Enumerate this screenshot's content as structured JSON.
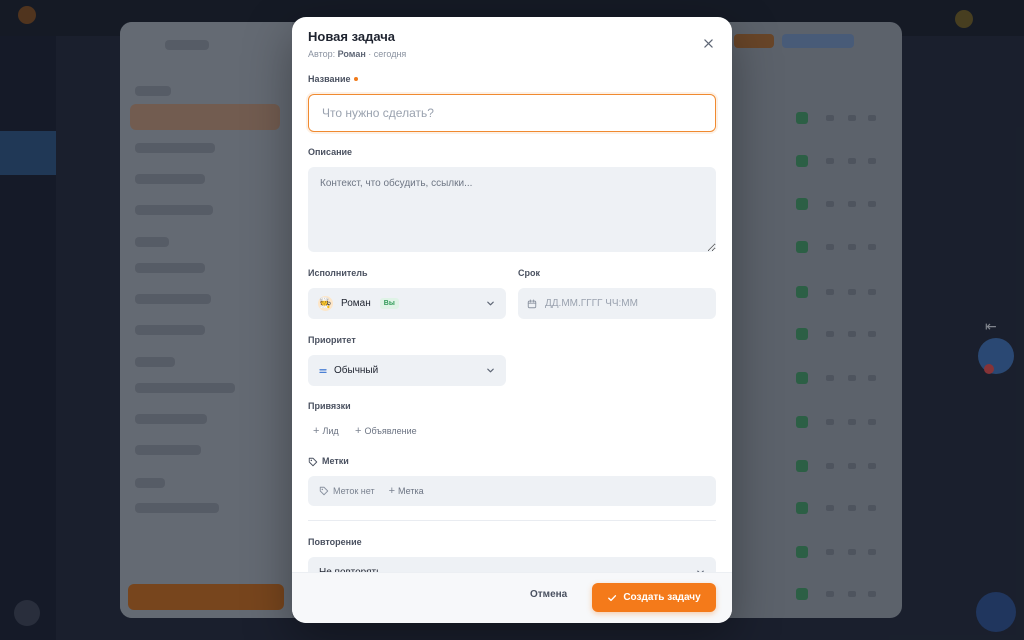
{
  "modal": {
    "title": "Новая задача",
    "author_prefix": "Автор:",
    "author_name": "Роман",
    "author_suffix": "· сегодня"
  },
  "fields": {
    "title_label": "Название",
    "title_placeholder": "Что нужно сделать?",
    "description_label": "Описание",
    "description_placeholder": "Контекст, что обсудить, ссылки...",
    "assignee_label": "Исполнитель",
    "assignee_value": "Роман",
    "assignee_badge": "Вы",
    "assignee_avatar": "🧑‍🍳",
    "due_label": "Срок",
    "due_placeholder": "ДД.ММ.ГГГГ ЧЧ:ММ",
    "priority_label": "Приоритет",
    "priority_value": "Обычный",
    "links_label": "Привязки",
    "link_lead": "Лид",
    "link_ad": "Объявление",
    "tags_label": "Метки",
    "tags_empty": "Меток нет",
    "tags_add": "Метка",
    "repeat_label": "Повторение",
    "repeat_value": "Не повторять"
  },
  "footer": {
    "cancel_label": "Отмена",
    "create_label": "Создать задачу"
  },
  "colors": {
    "accent": "#f47a1a",
    "focus_border": "#f08a30",
    "badge_green": "#2f9a57"
  },
  "icons": [
    "close-icon",
    "chevron-down-icon",
    "calendar-icon",
    "priority-equals-icon",
    "plus-icon",
    "tag-icon",
    "check-icon"
  ]
}
